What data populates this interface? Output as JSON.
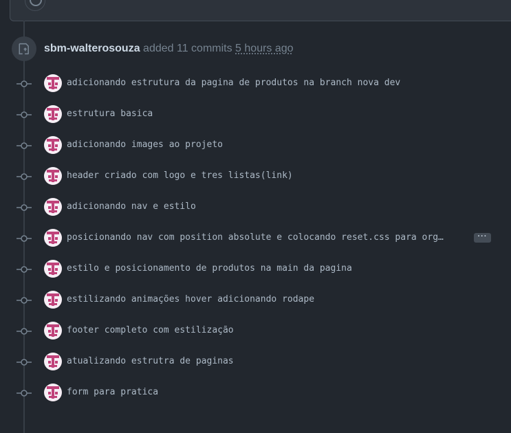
{
  "event": {
    "author": "sbm-walterosouza",
    "action": "added 11 commits",
    "time": "5 hours ago"
  },
  "more_label": "···",
  "commits": [
    {
      "message": "adicionando estrutura da pagina de produtos na branch nova dev",
      "truncated": false
    },
    {
      "message": "estrutura basica",
      "truncated": false
    },
    {
      "message": "adicionando images ao projeto",
      "truncated": false
    },
    {
      "message": "header criado com logo e tres listas(link)",
      "truncated": false
    },
    {
      "message": "adicionando nav e estilo",
      "truncated": false
    },
    {
      "message": "posicionando nav com position absolute e colocando reset.css para org…",
      "truncated": true
    },
    {
      "message": "estilo e posicionamento de produtos na main da pagina",
      "truncated": false
    },
    {
      "message": "estilizando animações hover adicionando rodape",
      "truncated": false
    },
    {
      "message": "footer completo com estilização",
      "truncated": false
    },
    {
      "message": "atualizando estrutra de paginas",
      "truncated": false
    },
    {
      "message": "form para pratica",
      "truncated": false
    }
  ],
  "colors": {
    "background": "#22272e",
    "avatar_accent": "#c0427a"
  }
}
